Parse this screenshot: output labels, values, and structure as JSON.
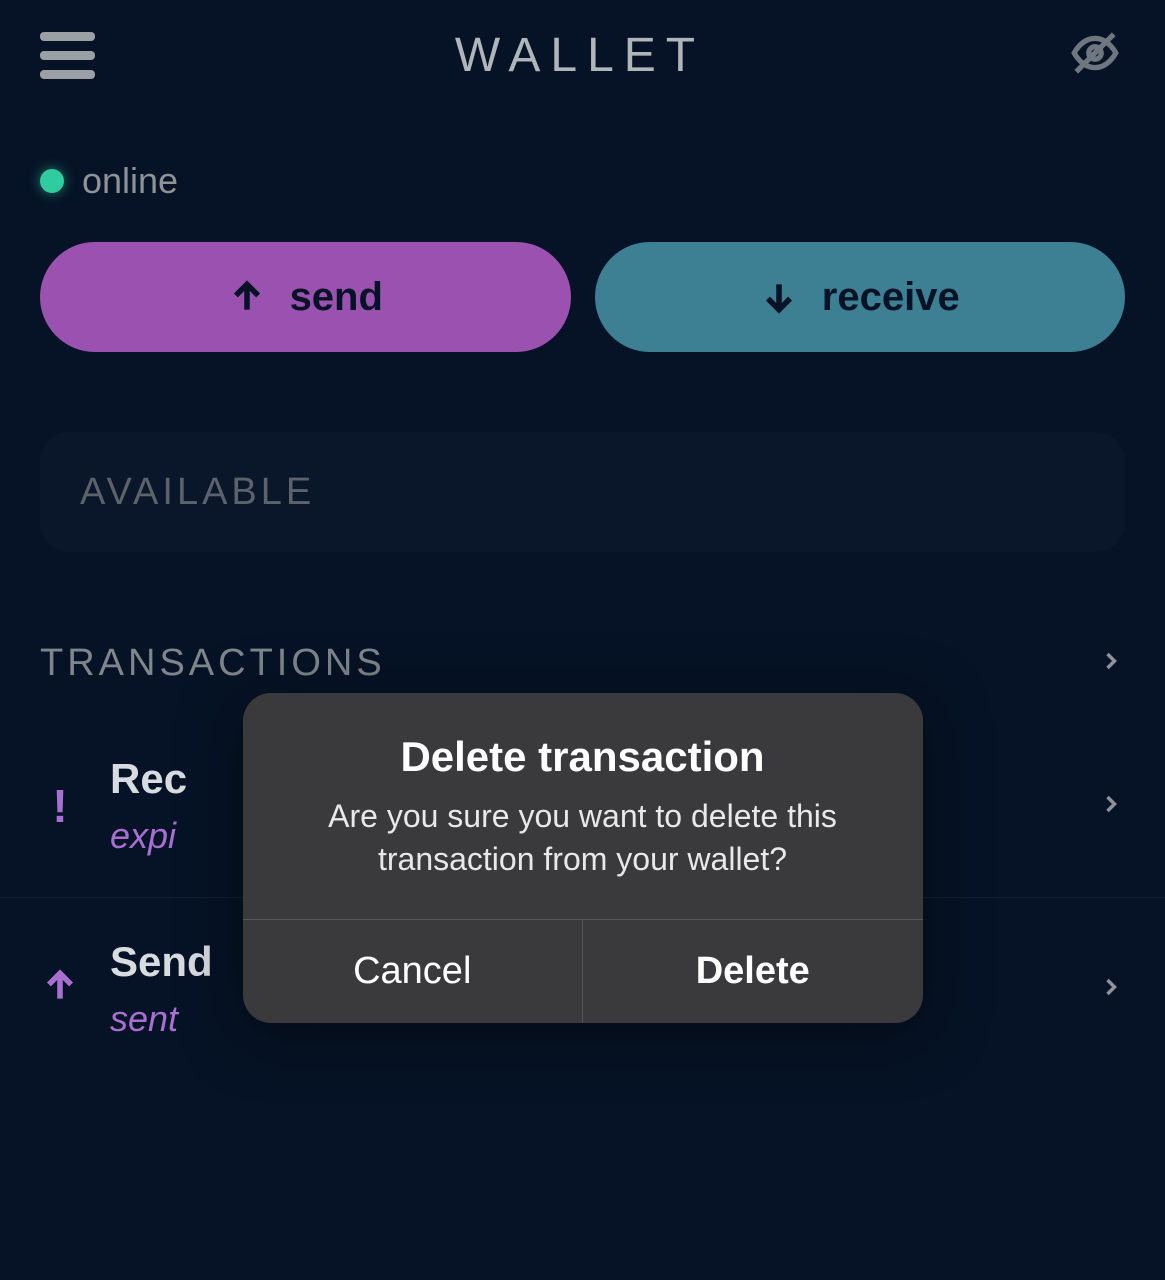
{
  "header": {
    "title": "WALLET"
  },
  "status": {
    "label": "online",
    "color": "#2ecc9e"
  },
  "actions": {
    "send_label": "send",
    "receive_label": "receive"
  },
  "balance": {
    "label": "AVAILABLE"
  },
  "transactions": {
    "heading": "TRANSACTIONS",
    "items": [
      {
        "title": "Rec",
        "subtitle": "expi",
        "icon": "alert"
      },
      {
        "title": "Send",
        "subtitle": "sent",
        "icon": "arrow-up"
      }
    ]
  },
  "modal": {
    "title": "Delete transaction",
    "message": "Are you sure you want to delete this transaction from your wallet?",
    "cancel_label": "Cancel",
    "confirm_label": "Delete"
  }
}
